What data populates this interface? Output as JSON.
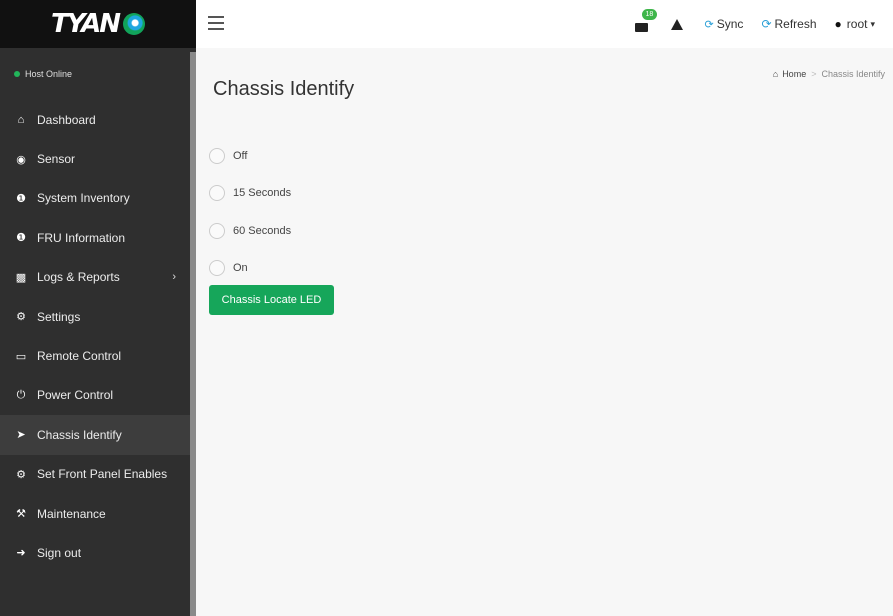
{
  "logo": {
    "text": "TYAN"
  },
  "sidebar": {
    "status": "Host Online",
    "items": [
      {
        "label": "Dashboard",
        "icon": "home-icon"
      },
      {
        "label": "Sensor",
        "icon": "sensor-icon"
      },
      {
        "label": "System Inventory",
        "icon": "info-icon"
      },
      {
        "label": "FRU Information",
        "icon": "info-icon"
      },
      {
        "label": "Logs & Reports",
        "icon": "bar-chart-icon",
        "has_submenu": true
      },
      {
        "label": "Settings",
        "icon": "gear-icon"
      },
      {
        "label": "Remote Control",
        "icon": "monitor-icon"
      },
      {
        "label": "Power Control",
        "icon": "power-icon"
      },
      {
        "label": "Chassis Identify",
        "icon": "rocket-icon",
        "active": true
      },
      {
        "label": "Set Front Panel Enables",
        "icon": "gears-icon"
      },
      {
        "label": "Maintenance",
        "icon": "wrench-icon"
      },
      {
        "label": "Sign out",
        "icon": "sign-out-icon"
      }
    ]
  },
  "topbar": {
    "messages_count": "18",
    "sync_label": "Sync",
    "refresh_label": "Refresh",
    "user_label": "root"
  },
  "breadcrumb": {
    "home": "Home",
    "current": "Chassis Identify"
  },
  "page": {
    "title": "Chassis Identify",
    "options": [
      "Off",
      "15 Seconds",
      "60 Seconds",
      "On"
    ],
    "button_label": "Chassis Locate LED"
  },
  "colors": {
    "accent_green": "#16a65a",
    "link_blue": "#2a9fd6",
    "sidebar_bg": "#2f2f2f"
  }
}
